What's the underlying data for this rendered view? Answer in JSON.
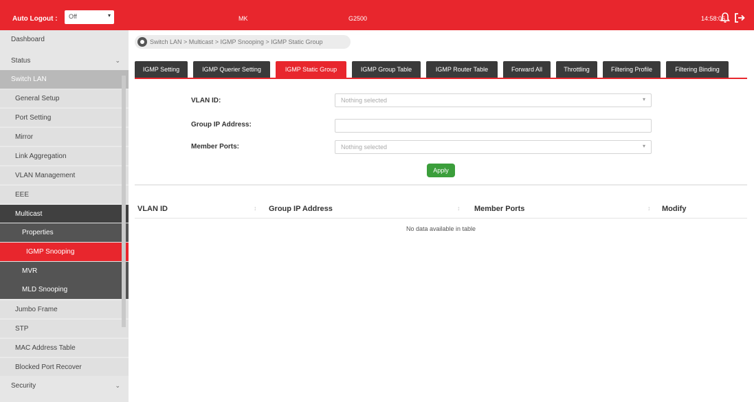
{
  "topbar": {
    "auto_logout_label": "Auto Logout :",
    "auto_logout_value": "Off",
    "host": "MK",
    "model": "G2500",
    "time": "14:58:06"
  },
  "sidebar": {
    "items": [
      {
        "label": "Dashboard"
      },
      {
        "label": "Status"
      },
      {
        "label": "Switch LAN"
      },
      {
        "label": "General Setup"
      },
      {
        "label": "Port Setting"
      },
      {
        "label": "Mirror"
      },
      {
        "label": "Link Aggregation"
      },
      {
        "label": "VLAN Management"
      },
      {
        "label": "EEE"
      },
      {
        "label": "Multicast"
      },
      {
        "label": "Properties"
      },
      {
        "label": "IGMP Snooping"
      },
      {
        "label": "MVR"
      },
      {
        "label": "MLD Snooping"
      },
      {
        "label": "Jumbo Frame"
      },
      {
        "label": "STP"
      },
      {
        "label": "MAC Address Table"
      },
      {
        "label": "Blocked Port Recover"
      },
      {
        "label": "Security"
      }
    ]
  },
  "breadcrumb": "Switch LAN > Multicast > IGMP Snooping > IGMP Static Group",
  "tabs": [
    {
      "label": "IGMP Setting"
    },
    {
      "label": "IGMP Querier Setting"
    },
    {
      "label": "IGMP Static Group"
    },
    {
      "label": "IGMP Group Table"
    },
    {
      "label": "IGMP Router Table"
    },
    {
      "label": "Forward All"
    },
    {
      "label": "Throttling"
    },
    {
      "label": "Filtering Profile"
    },
    {
      "label": "Filtering Binding"
    }
  ],
  "form": {
    "vlan_id_label": "VLAN ID:",
    "vlan_id_placeholder": "Nothing selected",
    "group_ip_label": "Group IP Address:",
    "group_ip_value": "",
    "member_ports_label": "Member Ports:",
    "member_ports_placeholder": "Nothing selected",
    "apply_label": "Apply"
  },
  "table": {
    "columns": [
      "VLAN ID",
      "Group IP Address",
      "Member Ports",
      "Modify"
    ],
    "empty_message": "No data available in table"
  },
  "colors": {
    "accent": "#e8262d",
    "tab_dark": "#3a3a3a",
    "apply_green": "#3b9e3b"
  }
}
